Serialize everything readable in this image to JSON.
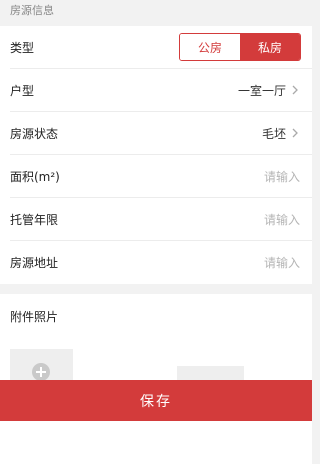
{
  "section": {
    "title": "房源信息"
  },
  "form": {
    "type": {
      "label": "类型",
      "options": [
        "公房",
        "私房"
      ],
      "selected": "私房"
    },
    "layout": {
      "label": "户型",
      "value": "一室一厅"
    },
    "status": {
      "label": "房源状态",
      "value": "毛坯"
    },
    "area": {
      "label": "面积(m²)",
      "placeholder": "请输入"
    },
    "term": {
      "label": "托管年限",
      "placeholder": "请输入"
    },
    "address": {
      "label": "房源地址",
      "placeholder": "请输入"
    }
  },
  "photos": {
    "title": "附件照片"
  },
  "footer": {
    "save_label": "保存"
  },
  "colors": {
    "accent": "#d33b3b",
    "placeholder": "#b5b5b5"
  }
}
